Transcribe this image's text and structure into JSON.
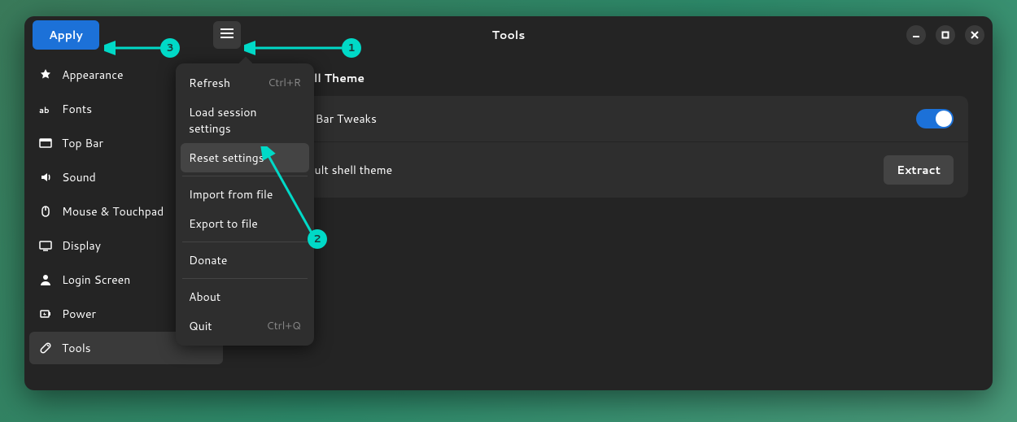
{
  "titlebar": {
    "apply_label": "Apply",
    "title": "Tools"
  },
  "sidebar": {
    "items": [
      {
        "label": "Appearance"
      },
      {
        "label": "Fonts"
      },
      {
        "label": "Top Bar"
      },
      {
        "label": "Sound"
      },
      {
        "label": "Mouse & Touchpad"
      },
      {
        "label": "Display"
      },
      {
        "label": "Login Screen"
      },
      {
        "label": "Power"
      },
      {
        "label": "Tools"
      }
    ],
    "active_index": 8
  },
  "content": {
    "section_title": "Default Shell Theme",
    "rows": [
      {
        "label": "Include Top Bar Tweaks",
        "control": "toggle",
        "value": true
      },
      {
        "label": "Extract default shell theme",
        "control": "button",
        "button_label": "Extract"
      }
    ]
  },
  "menu": {
    "items": [
      {
        "label": "Refresh",
        "accel": "Ctrl+R"
      },
      {
        "label": "Load session settings"
      },
      {
        "label": "Reset settings",
        "highlighted": true
      },
      {
        "sep": true
      },
      {
        "label": "Import from file"
      },
      {
        "label": "Export to file"
      },
      {
        "sep": true
      },
      {
        "label": "Donate"
      },
      {
        "sep": true
      },
      {
        "label": "About"
      },
      {
        "label": "Quit",
        "accel": "Ctrl+Q"
      }
    ]
  },
  "annotations": {
    "a1": "1",
    "a2": "2",
    "a3": "3"
  }
}
